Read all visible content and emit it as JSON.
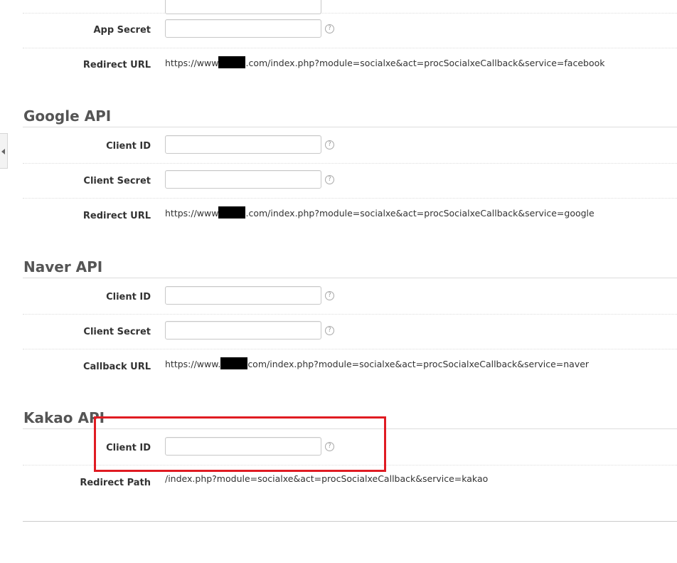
{
  "facebook": {
    "app_secret_label": "App Secret",
    "redirect_label": "Redirect URL",
    "redirect_prefix": "https://www",
    "redirect_suffix": ".com/index.php?module=socialxe&act=procSocialxeCallback&service=facebook"
  },
  "google": {
    "title": "Google API",
    "client_id_label": "Client ID",
    "client_secret_label": "Client Secret",
    "redirect_label": "Redirect URL",
    "redirect_prefix": "https://www",
    "redirect_suffix": ".com/index.php?module=socialxe&act=procSocialxeCallback&service=google"
  },
  "naver": {
    "title": "Naver API",
    "client_id_label": "Client ID",
    "client_secret_label": "Client Secret",
    "callback_label": "Callback URL",
    "callback_prefix": "https://www.",
    "callback_suffix": "com/index.php?module=socialxe&act=procSocialxeCallback&service=naver"
  },
  "kakao": {
    "title": "Kakao API",
    "client_id_label": "Client ID",
    "redirect_path_label": "Redirect Path",
    "redirect_path": "/index.php?module=socialxe&act=procSocialxeCallback&service=kakao"
  },
  "help_glyph": "?",
  "colors": {
    "highlight": "#e01b22",
    "section_title": "#555555"
  }
}
